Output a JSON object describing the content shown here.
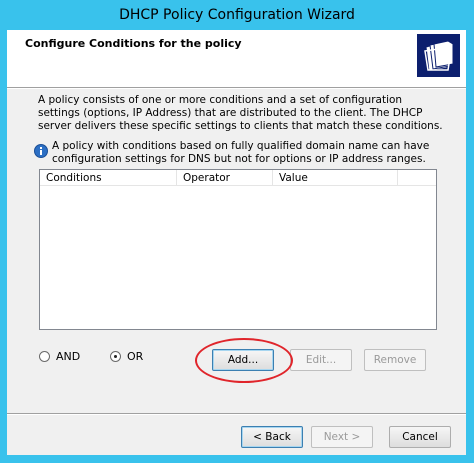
{
  "window": {
    "title": "DHCP Policy Configuration Wizard"
  },
  "header": {
    "title": "Configure Conditions for the policy",
    "icon": "folder-documents-icon"
  },
  "description": "A policy consists of one or more conditions and a set of configuration settings (options, IP Address) that are distributed to the client. The DHCP server delivers these specific settings to clients that match these conditions.",
  "info": {
    "icon": "info-icon",
    "text": "A policy with conditions based on fully qualified domain name can have configuration settings for DNS but not for options or IP address ranges."
  },
  "conditions_table": {
    "columns": [
      "Conditions",
      "Operator",
      "Value"
    ],
    "rows": []
  },
  "logic": {
    "and_label": "AND",
    "or_label": "OR",
    "selected": "OR"
  },
  "buttons": {
    "add": "Add...",
    "edit": "Edit...",
    "remove": "Remove",
    "back": "< Back",
    "next": "Next >",
    "cancel": "Cancel"
  },
  "colors": {
    "titlebar": "#39c2ec",
    "annotation_circle": "#e0252b",
    "icon_bg": "#0c1f6e"
  }
}
